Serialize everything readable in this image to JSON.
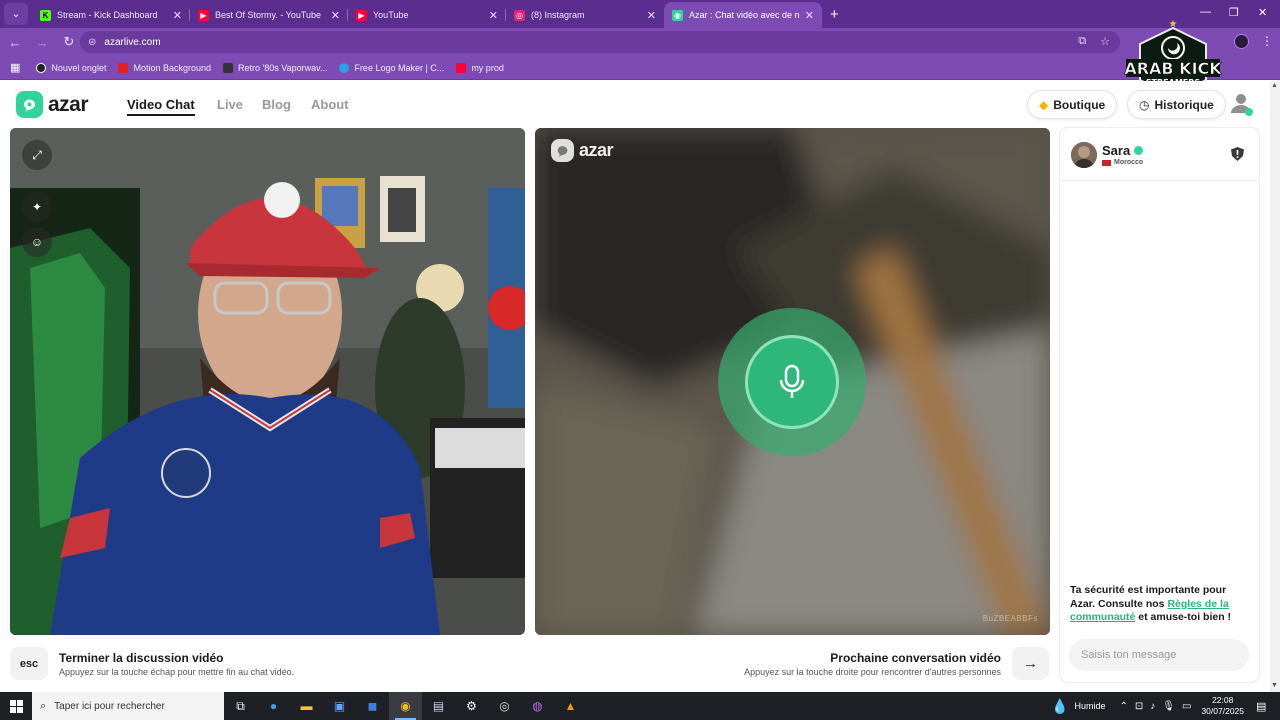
{
  "browser": {
    "menu_icon": "⌄",
    "tabs": [
      {
        "title": "Stream - Kick Dashboard",
        "favicon_color": "#53fc18",
        "favicon_glyph": "K"
      },
      {
        "title": "Best Of Stormy. - YouTube",
        "favicon_color": "#ff0033",
        "favicon_glyph": "▶"
      },
      {
        "title": "YouTube",
        "favicon_color": "#ff0033",
        "favicon_glyph": "▶"
      },
      {
        "title": "(8) Instagram",
        "favicon_color": "#d62976",
        "favicon_glyph": "◎"
      },
      {
        "title": "Azar : Chat vidéo avec de n",
        "favicon_color": "#2fd49a",
        "favicon_glyph": "◉"
      }
    ],
    "new_tab": "+",
    "window_controls": {
      "minimize": "—",
      "maximize": "❐",
      "close": "✕"
    },
    "url": "azarlive.com",
    "bookmarks": [
      {
        "label": "Nouvel onglet",
        "color": "#222222"
      },
      {
        "label": "Motion Background",
        "color": "#e02020"
      },
      {
        "label": "Retro '80s Vaporwav...",
        "color": "#333333"
      },
      {
        "label": "Free Logo Maker | C...",
        "color": "#29a0e8"
      },
      {
        "label": "my prod",
        "color": "#ff0033"
      }
    ]
  },
  "badge": {
    "line1": "ARAB KICK",
    "line2": "STREAMERS",
    "star": "★"
  },
  "azar": {
    "logo_text": "azar",
    "nav": [
      "Video Chat",
      "Live",
      "Blog",
      "About"
    ],
    "shop_label": "Boutique",
    "history_label": "Historique",
    "history_icon": "clock-icon",
    "shop_icon": "diamond-icon",
    "overlay_logo_text": "azar",
    "video_id": "BuZBEABBFs",
    "peer": {
      "name": "Sara",
      "country": "Morocco"
    },
    "safety": {
      "text1": "Ta sécurité est importante pour Azar. Consulte nos ",
      "link": "Règles de la communauté",
      "text2": " et amuse-toi bien !"
    },
    "message_placeholder": "Saisis ton message",
    "end": {
      "key": "esc",
      "title": "Terminer la discussion vidéo",
      "hint": "Appuyez sur la touche échap pour mettre fin au chat vidéo."
    },
    "next": {
      "title": "Prochaine conversation vidéo",
      "hint": "Appuyez sur la touche droite pour rencontrer d'autres personnes",
      "arrow": "→"
    },
    "accent": "#2fd49a"
  },
  "taskbar": {
    "search_placeholder": "Taper ici pour rechercher",
    "weather": "Humide",
    "time": "22:08",
    "date": "30/07/2025"
  }
}
